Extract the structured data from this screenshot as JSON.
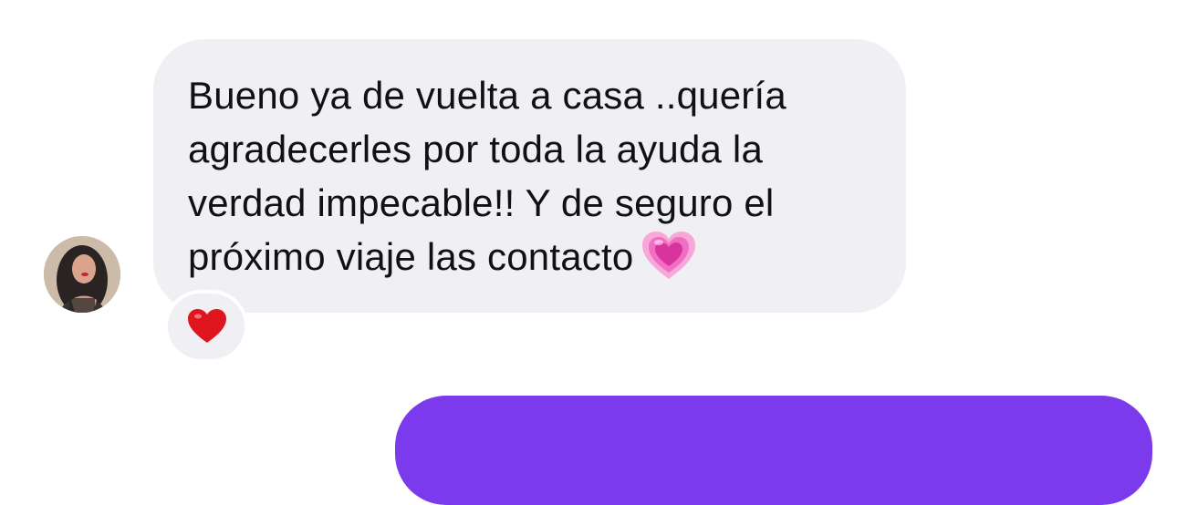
{
  "conversation": {
    "incoming_message": {
      "lines": [
        "Bueno ya de vuelta a casa ..quería",
        "agradecerles por toda la ayuda la",
        "verdad impecable!! Y de seguro el",
        "próximo viaje las contacto"
      ],
      "trailing_emoji": "growing-heart-emoji",
      "reaction": "red-heart-emoji",
      "bubble_color": "#efeff4"
    },
    "sender_avatar": "user-avatar",
    "outgoing_bubble_color": "#7c3aed"
  }
}
